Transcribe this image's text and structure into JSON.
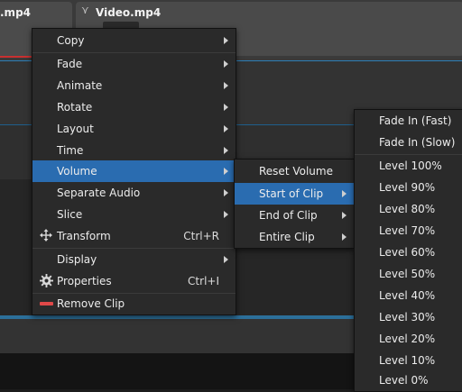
{
  "timeline": {
    "clip1_title": ".mp4",
    "clip2_title": "Video.mp4",
    "clip_chevron": "⋎"
  },
  "context_menu": {
    "items": [
      {
        "label": "Copy"
      },
      {
        "label": "Fade"
      },
      {
        "label": "Animate"
      },
      {
        "label": "Rotate"
      },
      {
        "label": "Layout"
      },
      {
        "label": "Time"
      },
      {
        "label": "Volume"
      },
      {
        "label": "Separate Audio"
      },
      {
        "label": "Slice"
      },
      {
        "label": "Transform",
        "shortcut": "Ctrl+R",
        "icon": "move-icon"
      },
      {
        "label": "Display"
      },
      {
        "label": "Properties",
        "shortcut": "Ctrl+I",
        "icon": "gear-icon"
      },
      {
        "label": "Remove Clip",
        "icon": "remove-icon"
      }
    ]
  },
  "volume_submenu": {
    "items": [
      {
        "label": "Reset Volume"
      },
      {
        "label": "Start of Clip"
      },
      {
        "label": "End of Clip"
      },
      {
        "label": "Entire Clip"
      }
    ]
  },
  "start_of_clip_submenu": {
    "items": [
      {
        "label": "Fade In (Fast)"
      },
      {
        "label": "Fade In (Slow)"
      },
      {
        "label": "Level 100%"
      },
      {
        "label": "Level 90%"
      },
      {
        "label": "Level 80%"
      },
      {
        "label": "Level 70%"
      },
      {
        "label": "Level 60%"
      },
      {
        "label": "Level 50%"
      },
      {
        "label": "Level 40%"
      },
      {
        "label": "Level 30%"
      },
      {
        "label": "Level 20%"
      },
      {
        "label": "Level 10%"
      },
      {
        "label": "Level 0%"
      }
    ]
  },
  "colors": {
    "highlight": "#2a6cb0",
    "menu_bg": "#2a2a2a",
    "remove_icon": "#e04848",
    "selected_clip_border": "#c93030"
  }
}
